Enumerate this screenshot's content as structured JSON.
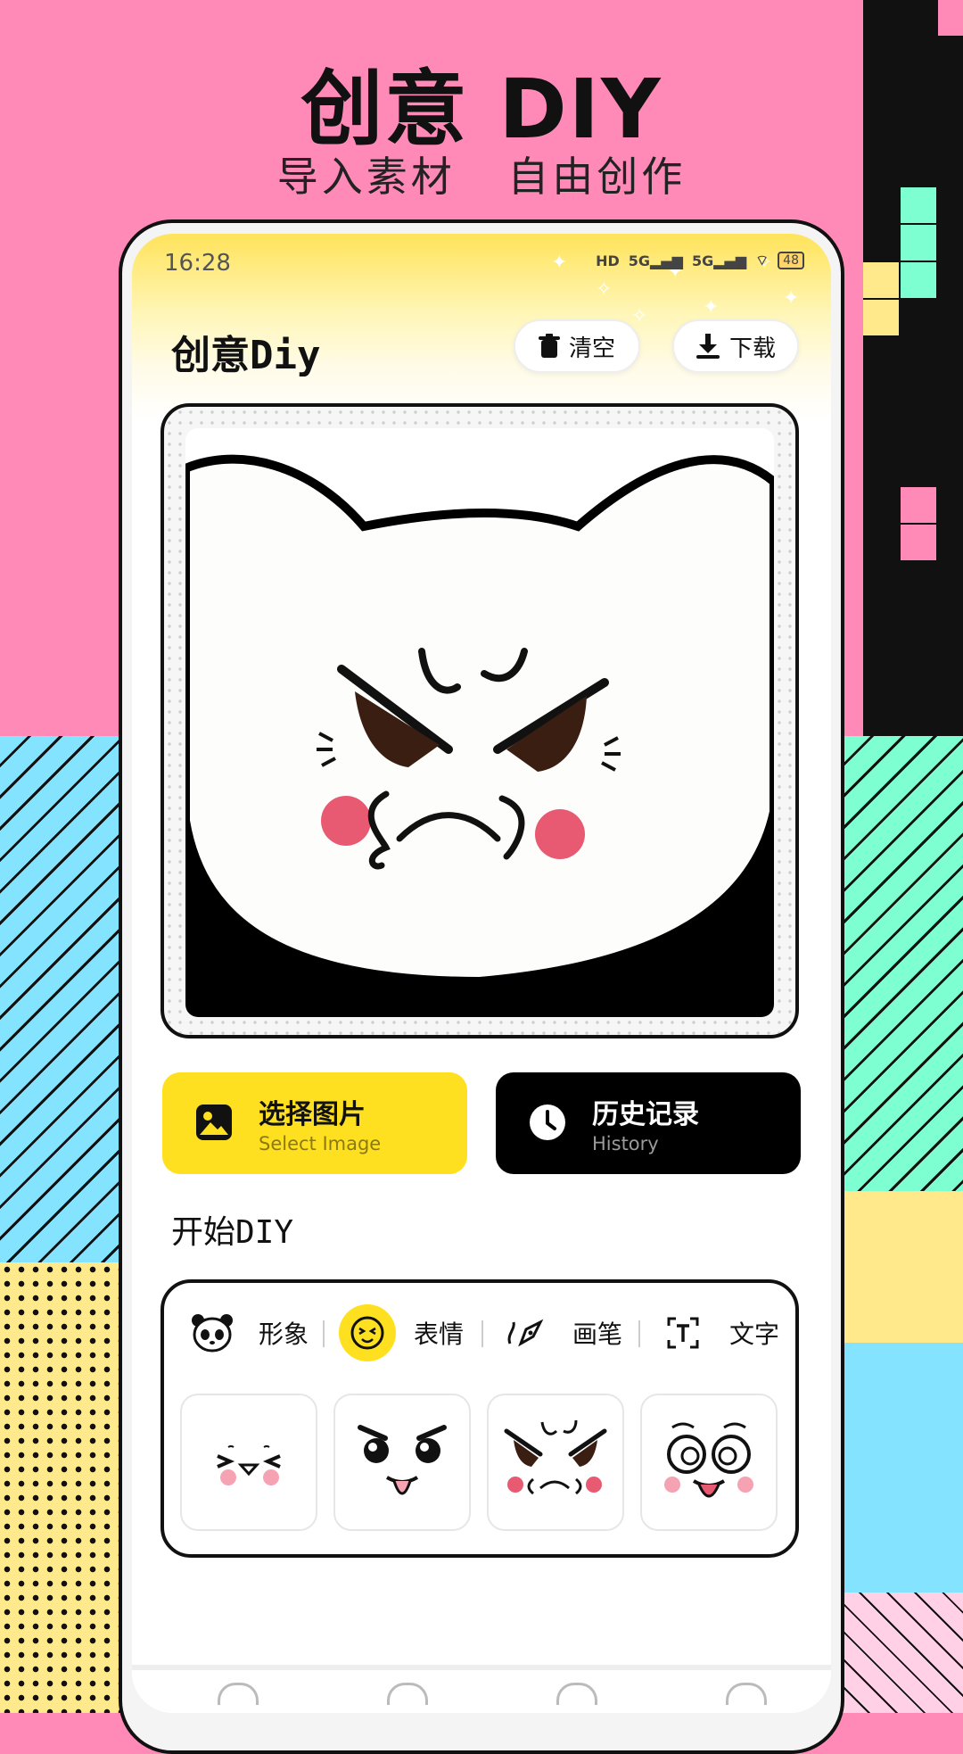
{
  "hero": {
    "title": "创意 DIY",
    "subtitle": "导入素材 自由创作"
  },
  "status_bar": {
    "time": "16:28",
    "icons": [
      "hd-icon",
      "5g-signal-icon",
      "5g-signal-icon",
      "wifi-icon",
      "battery-icon"
    ],
    "battery": "48"
  },
  "header": {
    "title": "创意Diy",
    "clear_label": "清空",
    "download_label": "下载"
  },
  "actions": {
    "select_image": {
      "label": "选择图片",
      "sublabel": "Select Image"
    },
    "history": {
      "label": "历史记录",
      "sublabel": "History"
    }
  },
  "section": {
    "title": "开始DIY"
  },
  "tool_tabs": [
    {
      "label": "形象",
      "icon": "panda-icon",
      "active": false
    },
    {
      "label": "表情",
      "icon": "face-icon",
      "active": true
    },
    {
      "label": "画笔",
      "icon": "pen-icon",
      "active": false
    },
    {
      "label": "文字",
      "icon": "text-icon",
      "active": false
    }
  ],
  "expressions": [
    "squint-laugh-face",
    "tongue-out-face",
    "angry-pout-face",
    "surprised-tongue-face"
  ],
  "colors": {
    "accent_yellow": "#ffe020",
    "background_pink": "#ff8ab8",
    "black": "#000000"
  }
}
